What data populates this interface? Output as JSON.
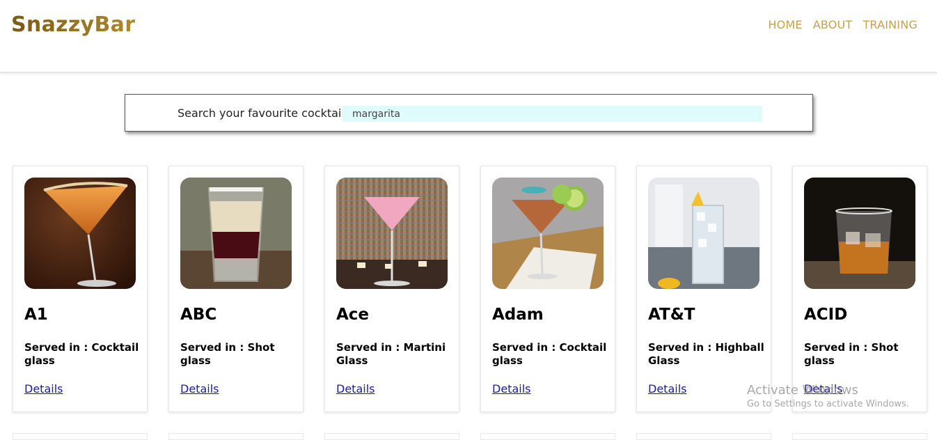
{
  "header": {
    "logo": "SnazzyBar",
    "nav": [
      "HOME",
      "ABOUT",
      "TRAINING"
    ]
  },
  "search": {
    "label": "Search your favourite cocktail",
    "value": "margarita"
  },
  "cocktails": [
    {
      "name": "A1",
      "served": "Served in : Cocktail glass",
      "link": "Details",
      "image": "cocktail-glass-orange-drink"
    },
    {
      "name": "ABC",
      "served": "Served in : Shot glass",
      "link": "Details",
      "image": "layered-shot-glass"
    },
    {
      "name": "Ace",
      "served": "Served in : Martini Glass",
      "link": "Details",
      "image": "pink-martini-with-candles"
    },
    {
      "name": "Adam",
      "served": "Served in : Cocktail glass",
      "link": "Details",
      "image": "cocktail-with-lime-garnish"
    },
    {
      "name": "AT&T",
      "served": "Served in : Highball Glass",
      "link": "Details",
      "image": "highball-with-lemon"
    },
    {
      "name": "ACID",
      "served": "Served in : Shot glass",
      "link": "Details",
      "image": "whiskey-rocks-glass"
    }
  ],
  "watermark": {
    "title": "Activate Windows",
    "subtitle": "Go to Settings to activate Windows."
  },
  "colors": {
    "brand": "#8a6b1c",
    "nav": "#c9a04a",
    "link": "#1a1aa6",
    "search_bg": "#e0fbfb"
  }
}
